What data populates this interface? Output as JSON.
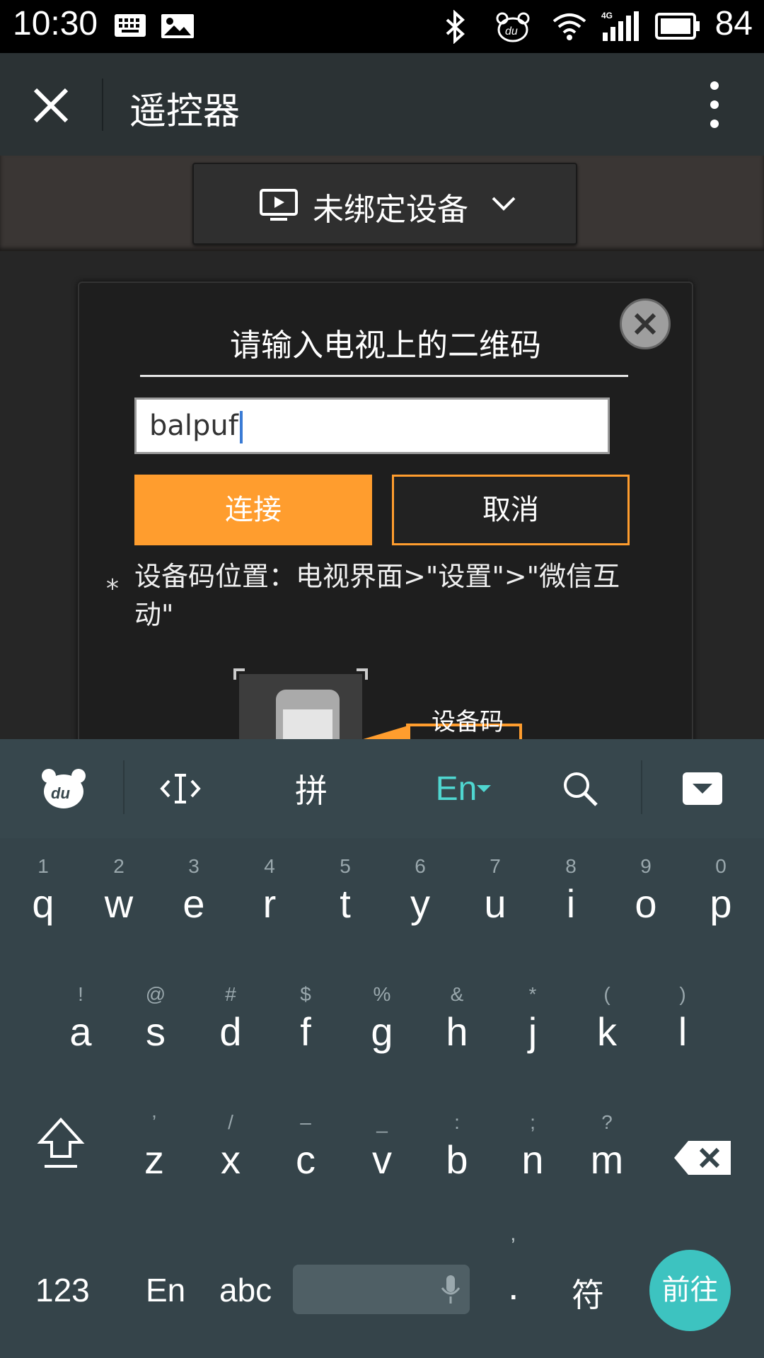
{
  "status": {
    "time": "10:30",
    "battery": "84",
    "network": "4G"
  },
  "header": {
    "title": "遥控器"
  },
  "device": {
    "label": "未绑定设备"
  },
  "dialog": {
    "title": "请输入电视上的二维码",
    "input_value": "balpuf",
    "connect_label": "连接",
    "cancel_label": "取消",
    "hint_star": "*",
    "hint": "设备码位置：电视界面>\"设置\">\"微信互动\"",
    "illustration_label": "设备码"
  },
  "keyboard": {
    "toolbar": {
      "pinyin": "拼",
      "lang": "En"
    },
    "row1": [
      {
        "c": "q",
        "h": "1"
      },
      {
        "c": "w",
        "h": "2"
      },
      {
        "c": "e",
        "h": "3"
      },
      {
        "c": "r",
        "h": "4"
      },
      {
        "c": "t",
        "h": "5"
      },
      {
        "c": "y",
        "h": "6"
      },
      {
        "c": "u",
        "h": "7"
      },
      {
        "c": "i",
        "h": "8"
      },
      {
        "c": "o",
        "h": "9"
      },
      {
        "c": "p",
        "h": "0"
      }
    ],
    "row2": [
      {
        "c": "a",
        "h": "!"
      },
      {
        "c": "s",
        "h": "@"
      },
      {
        "c": "d",
        "h": "#"
      },
      {
        "c": "f",
        "h": "$"
      },
      {
        "c": "g",
        "h": "%"
      },
      {
        "c": "h",
        "h": "&"
      },
      {
        "c": "j",
        "h": "*"
      },
      {
        "c": "k",
        "h": "("
      },
      {
        "c": "l",
        "h": ")"
      }
    ],
    "row3": [
      {
        "c": "z",
        "h": "’"
      },
      {
        "c": "x",
        "h": "/"
      },
      {
        "c": "c",
        "h": "–"
      },
      {
        "c": "v",
        "h": "_"
      },
      {
        "c": "b",
        "h": ":"
      },
      {
        "c": "n",
        "h": ";"
      },
      {
        "c": "m",
        "h": "?"
      }
    ],
    "bottom": {
      "num": "123",
      "en": "En",
      "abc": "abc",
      "period": ".",
      "comma": "’",
      "symbols": "符",
      "enter": "前往"
    }
  }
}
